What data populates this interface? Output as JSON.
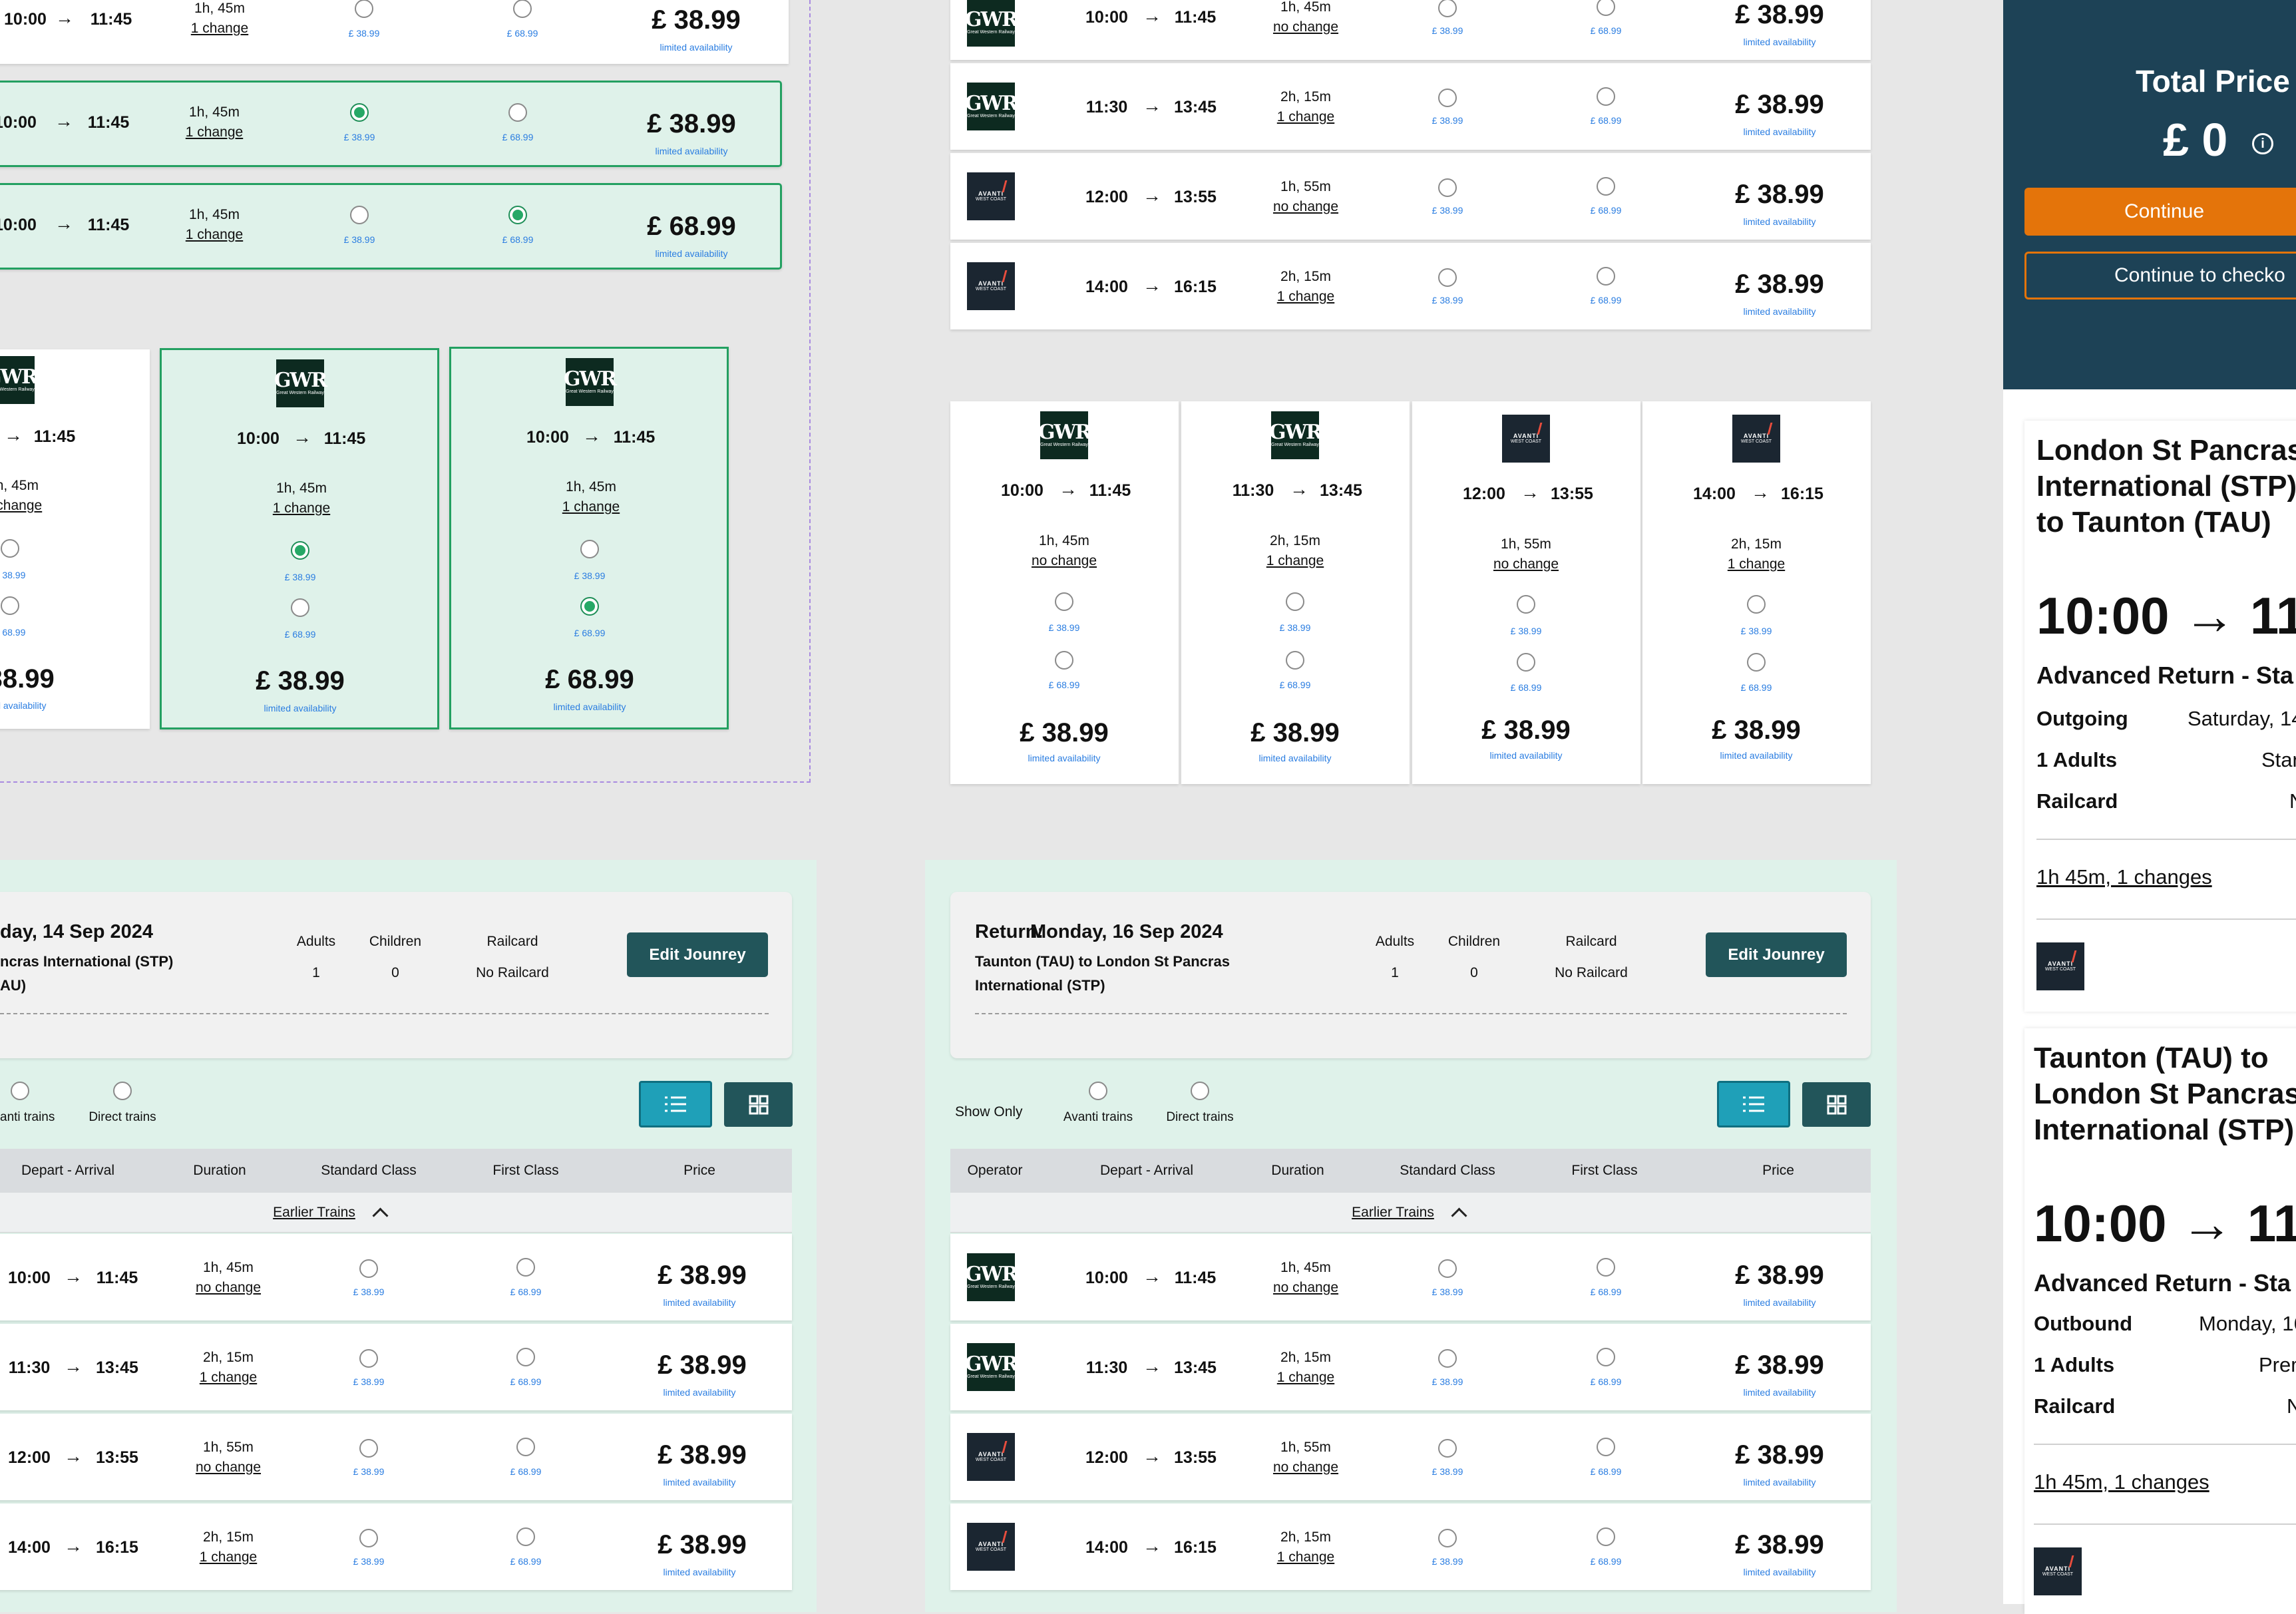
{
  "common": {
    "arrow": "→",
    "standard_price": "£ 38.99",
    "first_price": "£ 68.99",
    "price_38": "£ 38.99",
    "price_68": "£ 68.99",
    "limited": "limited availability",
    "gwr_logo": "GWR",
    "gwr_sub": "Great Western Railway",
    "avanti_logo": "AVANTI",
    "avanti_sub": "WEST COAST"
  },
  "journeys": [
    {
      "dep": "10:00",
      "arr": "11:45",
      "duration": "1h, 45m",
      "changes": "no change",
      "operator": "gwr"
    },
    {
      "dep": "11:30",
      "arr": "13:45",
      "duration": "2h, 15m",
      "changes": "1 change",
      "operator": "gwr"
    },
    {
      "dep": "12:00",
      "arr": "13:55",
      "duration": "1h, 55m",
      "changes": "no change",
      "operator": "avanti"
    },
    {
      "dep": "14:00",
      "arr": "16:15",
      "duration": "2h, 15m",
      "changes": "1 change",
      "operator": "avanti"
    }
  ],
  "states_list": [
    {
      "dep": "10:00",
      "arr": "11:45",
      "duration": "1h, 45m",
      "changes": "1 change",
      "price": "£ 38.99",
      "selected": "none"
    },
    {
      "dep": "10:00",
      "arr": "11:45",
      "duration": "1h, 45m",
      "changes": "1 change",
      "price": "£ 38.99",
      "selected": "standard"
    },
    {
      "dep": "10:00",
      "arr": "11:45",
      "duration": "1h, 45m",
      "changes": "1 change",
      "price": "£ 68.99",
      "selected": "first"
    }
  ],
  "states_cards": [
    {
      "dep": "10:00",
      "arr": "11:45",
      "duration": "1h, 45m",
      "changes": "1 change",
      "price": "£ 38.99",
      "selected": "none"
    },
    {
      "dep": "10:00",
      "arr": "11:45",
      "duration": "1h, 45m",
      "changes": "1 change",
      "price": "£ 38.99",
      "selected": "standard"
    },
    {
      "dep": "10:00",
      "arr": "11:45",
      "duration": "1h, 45m",
      "changes": "1 change",
      "price": "£ 68.99",
      "selected": "first"
    }
  ],
  "outbound_panel": {
    "title": "day, 14 Sep 2024",
    "route_line1": "ncras International (STP)",
    "route_line2": "AU)",
    "adults_label": "Adults",
    "adults_value": "1",
    "children_label": "Children",
    "children_value": "0",
    "railcard_label": "Railcard",
    "railcard_value": "No Railcard",
    "edit_button": "Edit Jounrey",
    "filter_avanti": "anti trains",
    "filter_direct": "Direct trains",
    "columns": [
      "Depart - Arrival",
      "Duration",
      "Standard Class",
      "First Class",
      "Price"
    ],
    "earlier": "Earlier Trains"
  },
  "return_panel": {
    "title_prefix": "Return:",
    "title": "Monday, 16 Sep 2024",
    "route_line1": "Taunton (TAU) to  London St Pancras",
    "route_line2": "International (STP)",
    "adults_label": "Adults",
    "adults_value": "1",
    "children_label": "Children",
    "children_value": "0",
    "railcard_label": "Railcard",
    "railcard_value": "No Railcard",
    "edit_button": "Edit Jounrey",
    "show_only": "Show Only",
    "filter_avanti": "Avanti trains",
    "filter_direct": "Direct trains",
    "columns": [
      "Operator",
      "Depart - Arrival",
      "Duration",
      "Standard Class",
      "First Class",
      "Price"
    ],
    "earlier": "Earlier Trains"
  },
  "summary": {
    "total_label": "Total Price",
    "total_value": "£ 0",
    "continue": "Continue",
    "continue_checkout": "Continue to checko",
    "outgoing": {
      "route": [
        "London St Pancras",
        "International (STP)",
        "to Taunton (TAU)"
      ],
      "times": "10:00 → 11:4",
      "ticket": "Advanced Return - Sta",
      "direction_label": "Outgoing",
      "direction_value": "Saturday, 14",
      "adults_label": "1  Adults",
      "adults_value": "Stan",
      "railcard_label": "Railcard",
      "railcard_value": "N",
      "duration_link": "1h 45m, 1 changes",
      "extra": "1"
    },
    "inbound": {
      "route": [
        "Taunton (TAU) to",
        "London St Pancras",
        "International (STP)"
      ],
      "times": "10:00 → 11:4",
      "ticket": "Advanced Return - Sta",
      "direction_label": "Outbound",
      "direction_value": "Monday, 16",
      "adults_label": "1  Adults",
      "adults_value": "Prem",
      "railcard_label": "Railcard",
      "railcard_value": "N",
      "duration_link": "1h 45m, 1 changes"
    }
  },
  "colors": {
    "selected_bg": "#dff2ea",
    "selected_border": "#23a061",
    "dark_teal": "#22555a",
    "summary_bg": "#1d4256",
    "orange": "#e4740a",
    "link_blue": "#2a7de1",
    "view_toggle_active": "#1fa0b8"
  }
}
